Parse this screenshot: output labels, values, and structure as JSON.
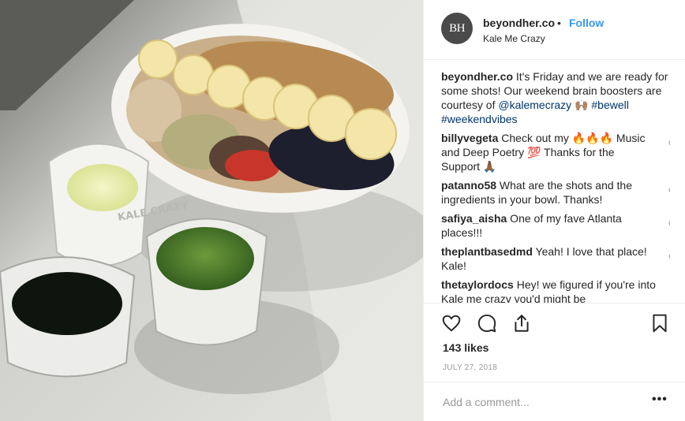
{
  "post": {
    "photo_alt": "",
    "glass_text": "KALE me CRAZY"
  },
  "header": {
    "avatar_initials": "BH",
    "username": "beyondher.co",
    "separator": "•",
    "follow_label": "Follow",
    "location": "Kale Me Crazy"
  },
  "caption": {
    "username": "beyondher.co",
    "text": " It's Friday and we are ready for some shots! Our weekend brain boosters are courtesy of ",
    "mention": "@kalemecrazy",
    "emoji": " 🙌🏽 ",
    "tag1": "#bewell",
    "tag2": "#weekendvibes"
  },
  "comments": [
    {
      "username": "billyvegeta",
      "text": " Check out my 🔥🔥🔥 Music and Deep Poetry 💯 Thanks for the Support 🙏🏾"
    },
    {
      "username": "patanno58",
      "text": " What are the shots and the ingredients in your bowl. Thanks!"
    },
    {
      "username": "safiya_aisha",
      "text": " One of my fave Atlanta places!!!"
    },
    {
      "username": "theplantbasedmd",
      "text": " Yeah! I love that place! Kale!"
    },
    {
      "username": "thetaylordocs",
      "text": " Hey! we figured if you're into Kale me crazy you'd might be"
    }
  ],
  "likes": "143 likes",
  "date": "JULY 27, 2018",
  "add_comment": {
    "placeholder": "Add a comment..."
  },
  "more_label": "•••",
  "colors": {
    "link": "#003569",
    "follow": "#3897f0",
    "muted": "#999999",
    "border": "#efefef"
  }
}
